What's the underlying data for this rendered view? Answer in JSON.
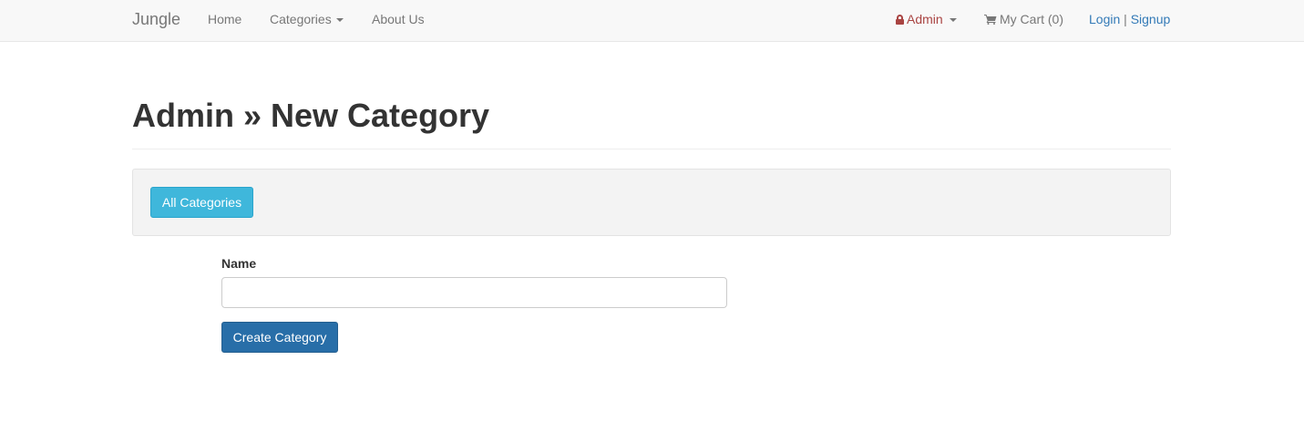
{
  "navbar": {
    "brand": "Jungle",
    "home": "Home",
    "categories": "Categories",
    "about": "About Us",
    "admin": "Admin",
    "cart": "My Cart (0)",
    "login": "Login",
    "separator": "|",
    "signup": "Signup",
    "icons": {
      "admin": "lock-icon",
      "cart": "shopping-cart-icon",
      "dropdown": "caret-down-icon"
    },
    "colors": {
      "admin": "#a94442",
      "auth_links": "#337ab7",
      "link": "#777777"
    }
  },
  "page": {
    "title": "Admin » New Category"
  },
  "toolbar": {
    "all_categories_label": "All Categories",
    "color": "#3fb7db"
  },
  "form": {
    "name_label": "Name",
    "name_value": "",
    "name_placeholder": "",
    "submit_label": "Create Category",
    "submit_color": "#286ea8"
  }
}
